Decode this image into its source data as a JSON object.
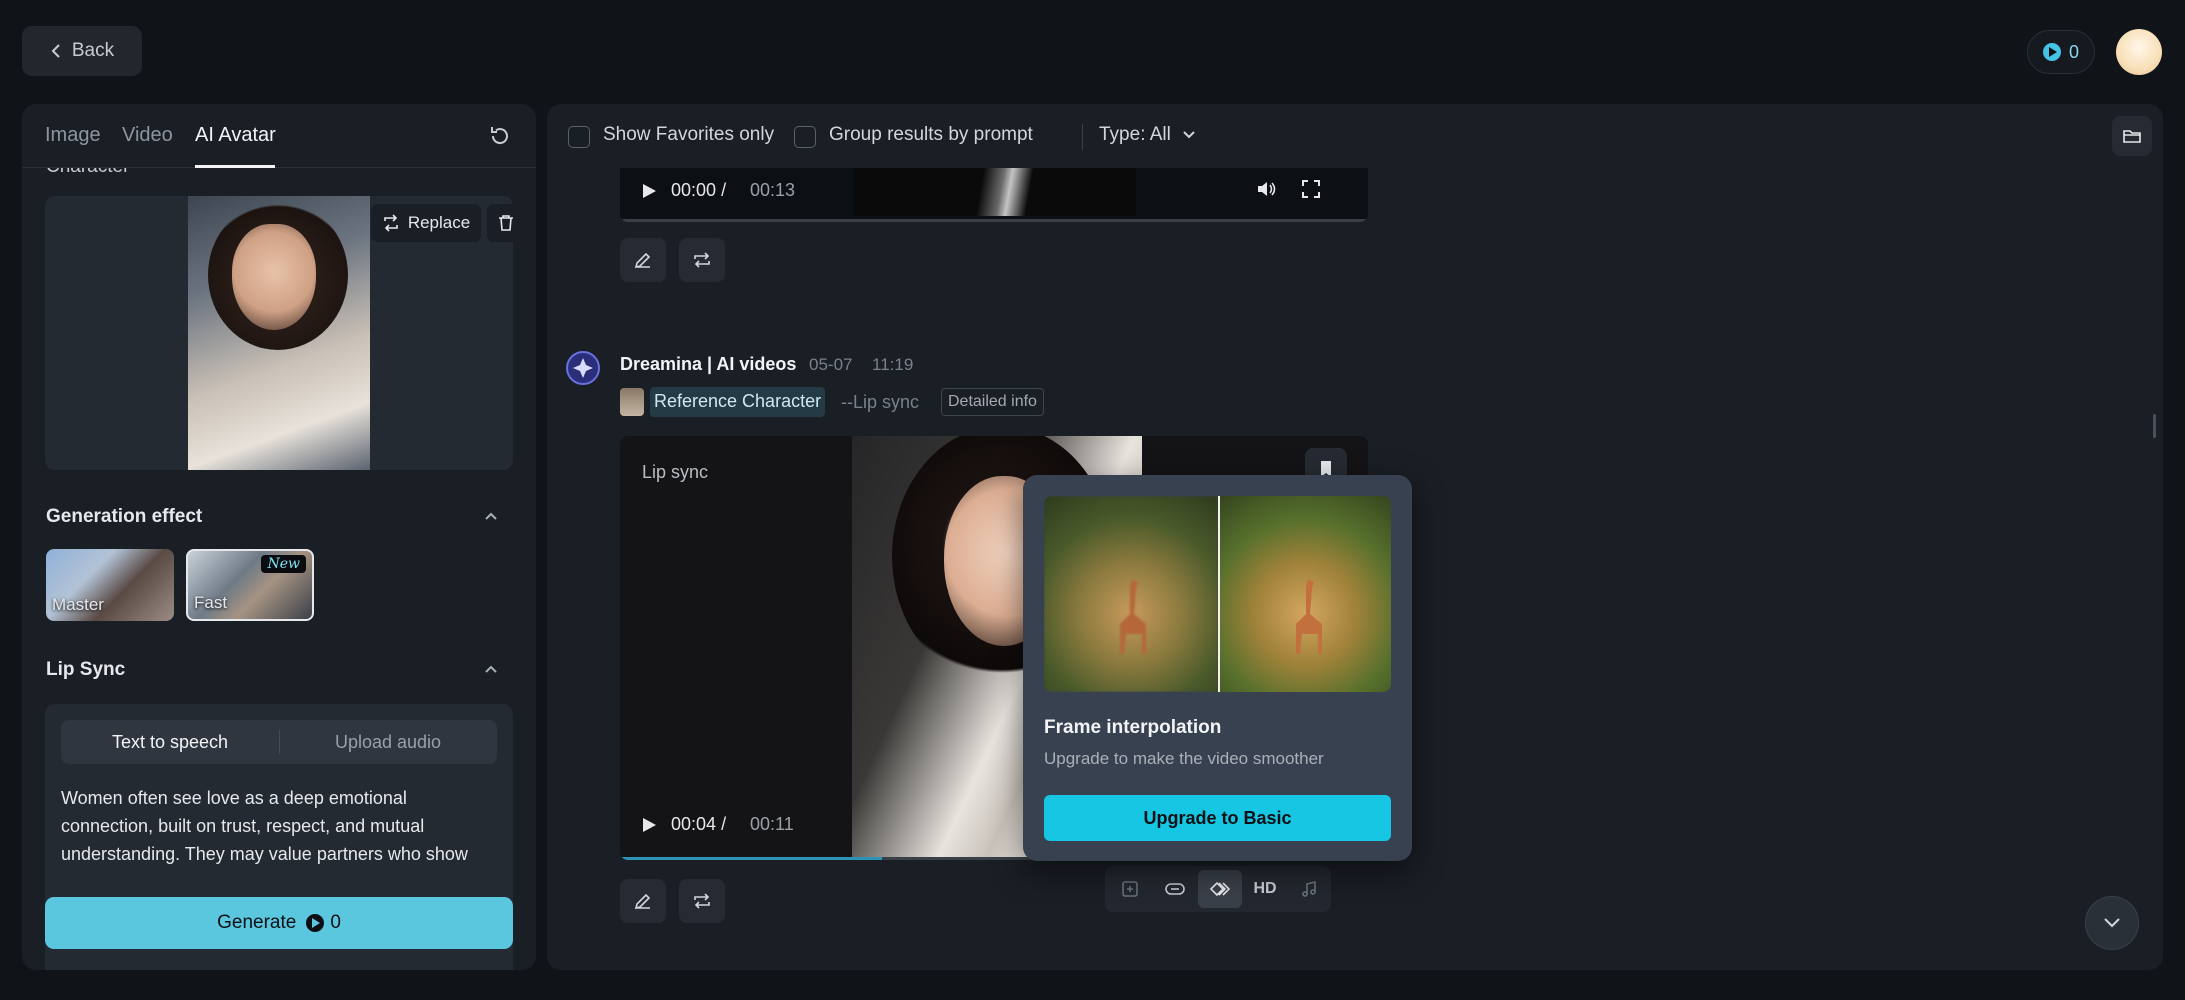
{
  "header": {
    "back_label": "Back",
    "credits": "0"
  },
  "left": {
    "tabs": [
      {
        "label": "Image"
      },
      {
        "label": "Video"
      },
      {
        "label": "AI Avatar"
      }
    ],
    "character_label": "Character",
    "replace_label": "Replace",
    "generation_effect": {
      "title": "Generation effect",
      "options": [
        {
          "label": "Master"
        },
        {
          "label": "Fast",
          "badge": "New"
        }
      ]
    },
    "lip_sync": {
      "title": "Lip Sync",
      "toggle": [
        "Text to speech",
        "Upload audio"
      ],
      "text": "Women often see love as a deep emotional connection, built on trust, respect, and mutual understanding. They may value partners who show"
    },
    "generate": {
      "label": "Generate",
      "credits": "0"
    }
  },
  "right": {
    "filters": {
      "favorites": "Show Favorites only",
      "group": "Group results by prompt",
      "type": "Type: All"
    },
    "video1": {
      "current": "00:00",
      "separator": "/",
      "total": "00:13"
    },
    "result": {
      "brand": "Dreamina | AI videos",
      "date": "05-07",
      "time": "11:19",
      "reference": "Reference Character",
      "mode": "--Lip sync",
      "details": "Detailed info",
      "video_label": "Lip sync",
      "current": "00:04",
      "separator": "/",
      "total": "00:11",
      "progress": 0.35
    },
    "actions": {
      "hd": "HD"
    }
  },
  "popup": {
    "title": "Frame interpolation",
    "subtitle": "Upgrade to make the video smoother",
    "button": "Upgrade to Basic"
  }
}
